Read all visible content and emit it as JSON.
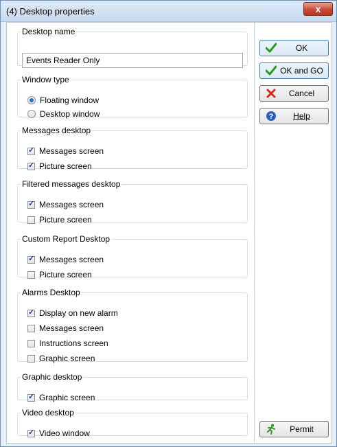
{
  "window": {
    "title": "(4) Desktop properties",
    "close_glyph": "x"
  },
  "desktop_name": {
    "legend": "Desktop name",
    "value": "Events Reader Only"
  },
  "window_type": {
    "legend": "Window type",
    "options": [
      {
        "label": "Floating window",
        "selected": true
      },
      {
        "label": "Desktop window",
        "selected": false
      }
    ]
  },
  "messages_desktop": {
    "legend": "Messages desktop",
    "items": [
      {
        "label": "Messages screen",
        "checked": true
      },
      {
        "label": "Picture screen",
        "checked": true
      }
    ]
  },
  "filtered_messages_desktop": {
    "legend": "Filtered messages desktop",
    "items": [
      {
        "label": "Messages screen",
        "checked": true
      },
      {
        "label": "Picture screen",
        "checked": false
      }
    ]
  },
  "custom_report_desktop": {
    "legend": "Custom Report Desktop",
    "items": [
      {
        "label": "Messages screen",
        "checked": true
      },
      {
        "label": "Picture screen",
        "checked": false
      }
    ]
  },
  "alarms_desktop": {
    "legend": "Alarms Desktop",
    "items": [
      {
        "label": "Display on new alarm",
        "checked": true
      },
      {
        "label": "Messages screen",
        "checked": false
      },
      {
        "label": "Instructions screen",
        "checked": false
      },
      {
        "label": "Graphic screen",
        "checked": false
      }
    ]
  },
  "graphic_desktop": {
    "legend": "Graphic desktop",
    "items": [
      {
        "label": "Graphic screen",
        "checked": true
      }
    ]
  },
  "video_desktop": {
    "legend": "Video desktop",
    "items": [
      {
        "label": "Video window",
        "checked": true
      }
    ]
  },
  "buttons": {
    "ok": {
      "label": "OK",
      "icon": "check-icon"
    },
    "ok_and_go": {
      "label": "OK and GO",
      "icon": "check-icon"
    },
    "cancel": {
      "label": "Cancel",
      "icon": "cross-icon"
    },
    "help": {
      "label": "Help",
      "icon": "help-icon"
    },
    "permit": {
      "label": "Permit",
      "icon": "running-man-icon"
    }
  },
  "colors": {
    "check_green": "#2a9a1c",
    "cancel_red": "#d42a1c",
    "help_blue": "#2a5fbf",
    "title_bar": "#c8d9ee"
  }
}
